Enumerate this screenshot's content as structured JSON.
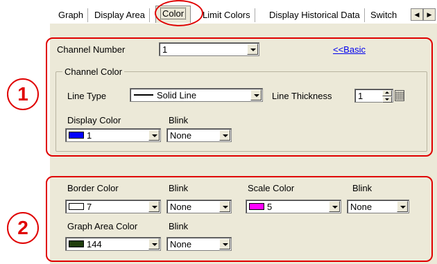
{
  "tabs": [
    {
      "label": "Graph"
    },
    {
      "label": "Display Area"
    },
    {
      "label": "Color"
    },
    {
      "label": "Limit Colors"
    },
    {
      "label": "Display Historical Data"
    },
    {
      "label": "Switch"
    }
  ],
  "section1": {
    "callout": "1",
    "channel_number_label": "Channel Number",
    "channel_number_value": "1",
    "basic_link": "<<Basic",
    "channel_color_title": "Channel Color",
    "line_type_label": "Line Type",
    "line_type_value": "Solid Line",
    "line_thickness_label": "Line Thickness",
    "line_thickness_value": "1",
    "display_color_label": "Display Color",
    "display_color_value": "1",
    "display_color_hex": "#0000ff",
    "blink_label": "Blink",
    "blink_value": "None"
  },
  "section2": {
    "callout": "2",
    "border_color_label": "Border Color",
    "border_color_value": "7",
    "border_color_hex": "#ffffff",
    "border_blink_label": "Blink",
    "border_blink_value": "None",
    "scale_color_label": "Scale Color",
    "scale_color_value": "5",
    "scale_color_hex": "#ff00ff",
    "scale_blink_label": "Blink",
    "scale_blink_value": "None",
    "graph_area_color_label": "Graph Area Color",
    "graph_area_color_value": "144",
    "graph_area_color_hex": "#1f3d0c",
    "graph_area_blink_label": "Blink",
    "graph_area_blink_value": "None"
  },
  "colors": {
    "highlight": "#e00000",
    "panel": "#ece9d8",
    "link": "#0000ee"
  }
}
